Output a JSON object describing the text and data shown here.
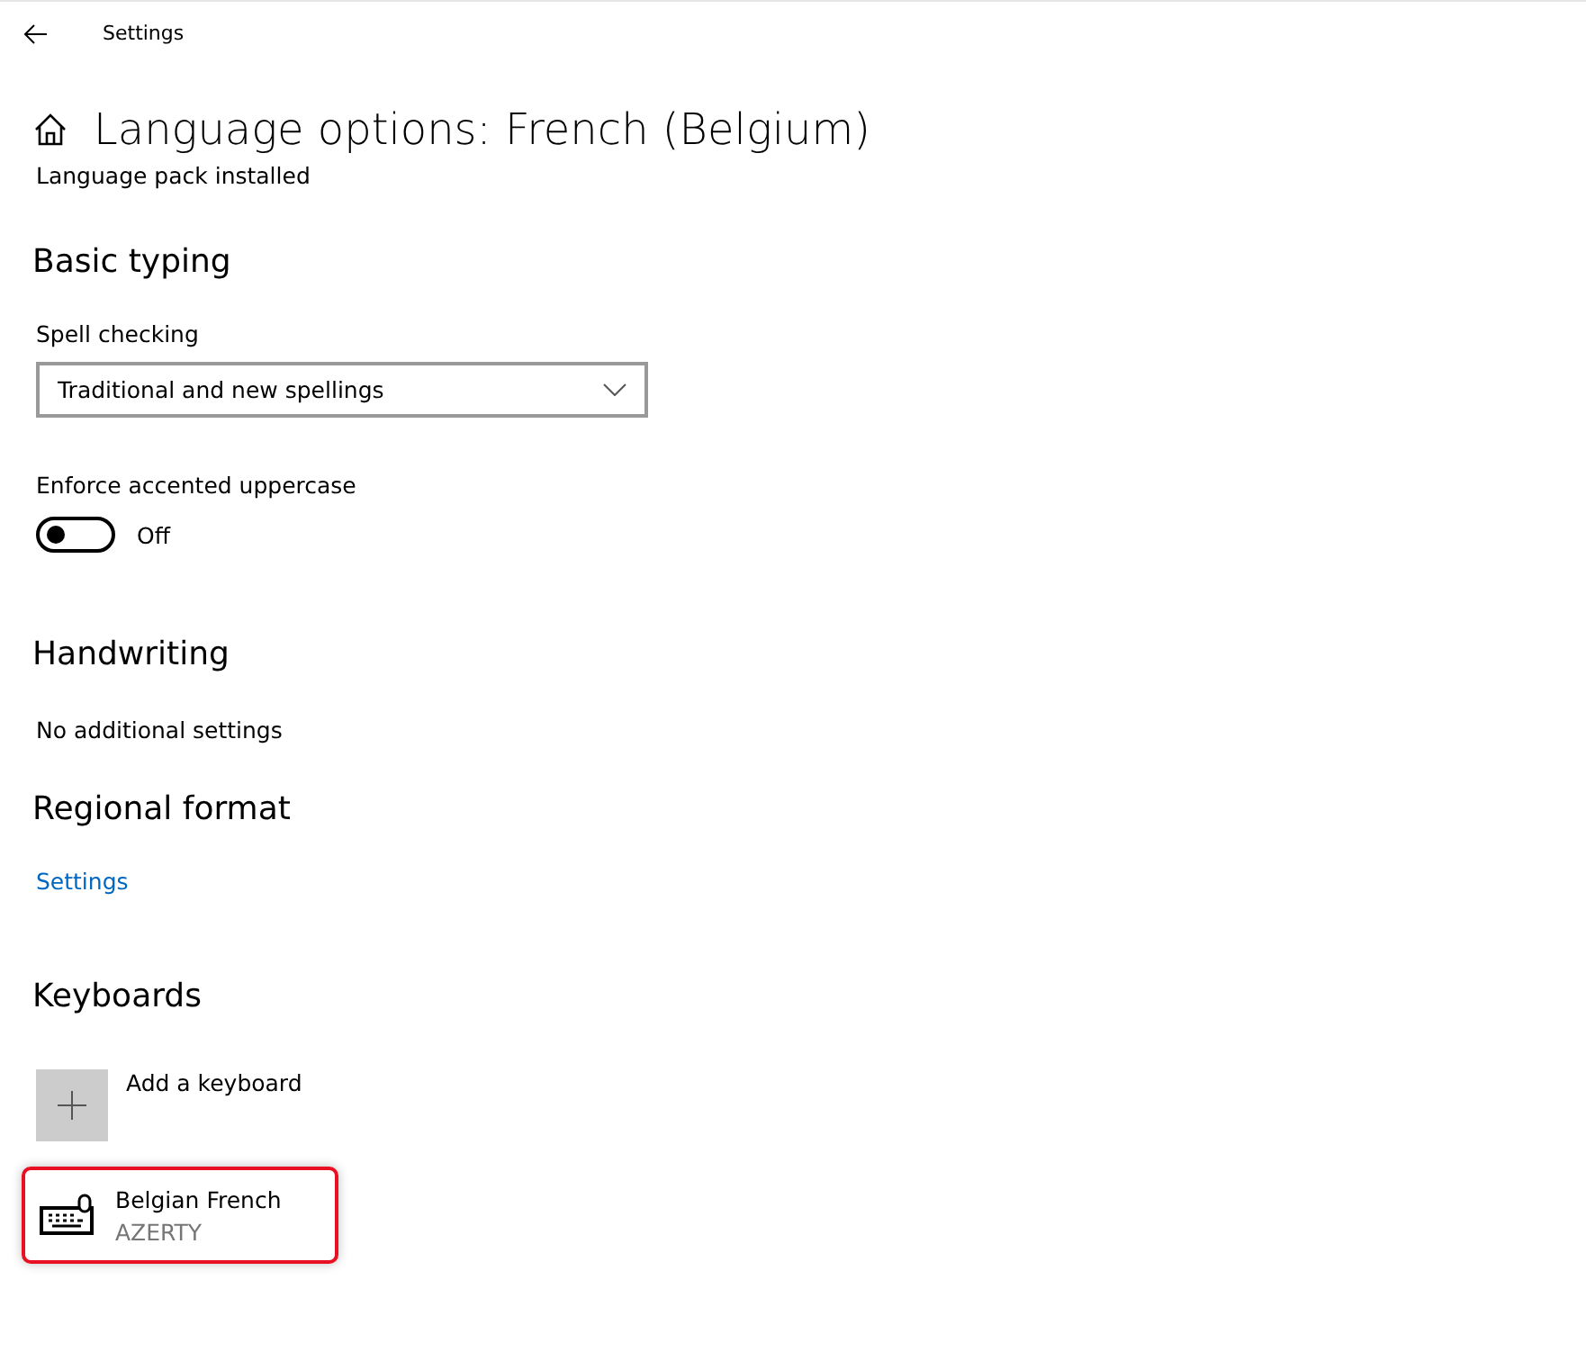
{
  "window": {
    "title": "Settings"
  },
  "page_title": "Language options: French (Belgium)",
  "status": "Language pack installed",
  "basic_typing": {
    "heading": "Basic typing",
    "spell_label": "Spell checking",
    "spell_value": "Traditional and new spellings",
    "accent_label": "Enforce accented uppercase",
    "accent_on": false,
    "accent_state": "Off"
  },
  "handwriting": {
    "heading": "Handwriting",
    "note": "No additional settings"
  },
  "regional": {
    "heading": "Regional format",
    "link": "Settings"
  },
  "keyboards": {
    "heading": "Keyboards",
    "add_label": "Add a keyboard",
    "items": [
      {
        "name": "Belgian French",
        "layout": "AZERTY",
        "highlighted": true
      }
    ]
  }
}
